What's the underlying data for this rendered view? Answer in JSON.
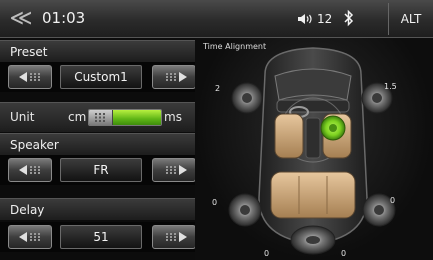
{
  "status_bar": {
    "back_icon": "double-chevron-left-icon",
    "time": "01:03",
    "volume_icon": "speaker-volume-icon",
    "volume_level": "12",
    "bluetooth_icon": "bluetooth-icon",
    "alt_label": "ALT"
  },
  "controls": {
    "preset_label": "Preset",
    "preset_value": "Custom1",
    "unit_label": "Unit",
    "unit_option_left": "cm",
    "unit_option_right": "ms",
    "unit_selected": "ms",
    "speaker_label": "Speaker",
    "speaker_value": "FR",
    "delay_label": "Delay",
    "delay_value": "51",
    "arrow_left_icon": "arrow-left-icon",
    "arrow_right_icon": "arrow-right-icon"
  },
  "diagram": {
    "title": "Time Alignment",
    "speaker_values": {
      "front_left": "2",
      "front_right": "1.5",
      "rear_left": "0",
      "rear_right": "0",
      "subwoofer_left": "0",
      "subwoofer_right": "0"
    },
    "selected_speaker": "FR",
    "accent_color": "#7ed321"
  }
}
